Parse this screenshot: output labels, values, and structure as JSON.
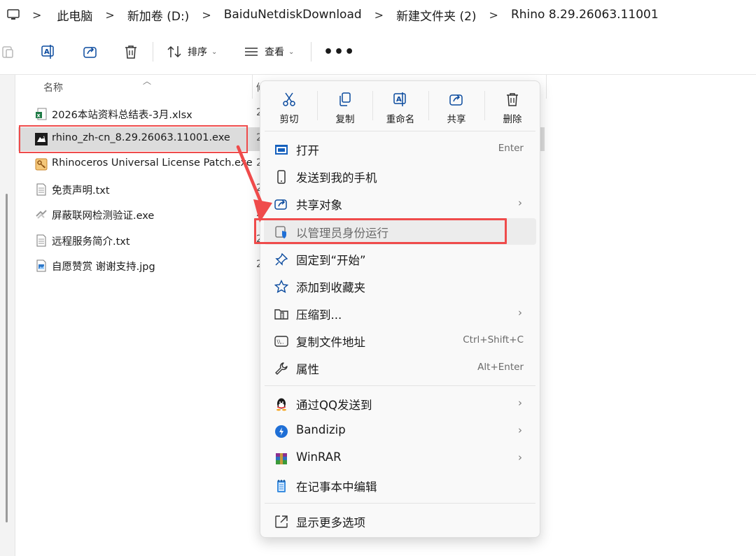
{
  "breadcrumb": {
    "items": [
      "此电脑",
      "新加卷 (D:)",
      "BaiduNetdiskDownload",
      "新建文件夹 (2)",
      "Rhino 8.29.26063.11001"
    ]
  },
  "toolbar": {
    "sort_label": "排序",
    "view_label": "查看",
    "more_label": "•••"
  },
  "file_list": {
    "column_name": "名称",
    "column_second_fragment": "修",
    "files": [
      {
        "name": "2026本站资料总结表-3月.xlsx",
        "date_fragment": "2",
        "icon": "excel-file-icon"
      },
      {
        "name": "rhino_zh-cn_8.29.26063.11001.exe",
        "date_fragment": "2",
        "icon": "rhino-app-icon",
        "selected": true
      },
      {
        "name": "Rhinoceros Universal License Patch.exe",
        "date_fragment": "2",
        "icon": "key-patch-icon"
      },
      {
        "name": "免责声明.txt",
        "date_fragment": "2",
        "icon": "text-file-icon"
      },
      {
        "name": "屏蔽联网检测验证.exe",
        "date_fragment": "2",
        "icon": "exe-file-icon"
      },
      {
        "name": "远程服务简介.txt",
        "date_fragment": "2",
        "icon": "text-file-icon"
      },
      {
        "name": "自愿赞赏 谢谢支持.jpg",
        "date_fragment": "2",
        "icon": "image-file-icon"
      }
    ]
  },
  "context_menu": {
    "quick_actions": [
      {
        "label": "剪切",
        "icon": "cut-icon"
      },
      {
        "label": "复制",
        "icon": "copy-icon"
      },
      {
        "label": "重命名",
        "icon": "rename-icon"
      },
      {
        "label": "共享",
        "icon": "share-icon"
      },
      {
        "label": "删除",
        "icon": "delete-icon"
      }
    ],
    "items": [
      {
        "label": "打开",
        "shortcut": "Enter",
        "submenu": false,
        "icon": "open-icon"
      },
      {
        "label": "发送到我的手机",
        "shortcut": "",
        "submenu": false,
        "icon": "phone-icon"
      },
      {
        "label": "共享对象",
        "shortcut": "",
        "submenu": true,
        "icon": "share-to-icon"
      },
      {
        "label": "以管理员身份运行",
        "shortcut": "",
        "submenu": false,
        "icon": "shield-icon",
        "highlighted": true
      },
      {
        "label": "固定到“开始”",
        "shortcut": "",
        "submenu": false,
        "icon": "pin-icon"
      },
      {
        "label": "添加到收藏夹",
        "shortcut": "",
        "submenu": false,
        "icon": "star-icon"
      },
      {
        "label": "压缩到...",
        "shortcut": "",
        "submenu": true,
        "icon": "zip-folder-icon"
      },
      {
        "label": "复制文件地址",
        "shortcut": "Ctrl+Shift+C",
        "submenu": false,
        "icon": "copy-path-icon"
      },
      {
        "label": "属性",
        "shortcut": "Alt+Enter",
        "submenu": false,
        "icon": "wrench-icon"
      },
      {
        "label": "通过QQ发送到",
        "shortcut": "",
        "submenu": true,
        "icon": "qq-icon"
      },
      {
        "label": "Bandizip",
        "shortcut": "",
        "submenu": true,
        "icon": "bandizip-icon"
      },
      {
        "label": "WinRAR",
        "shortcut": "",
        "submenu": true,
        "icon": "winrar-icon"
      },
      {
        "label": "在记事本中编辑",
        "shortcut": "",
        "submenu": false,
        "icon": "notepad-icon"
      },
      {
        "label": "显示更多选项",
        "shortcut": "",
        "submenu": false,
        "icon": "more-options-icon"
      }
    ],
    "submenu_glyph": "›"
  },
  "colors": {
    "annotation_red": "#ef4b4b",
    "selection_gray": "#dcdcdc",
    "menu_bg": "#f9f9f9"
  }
}
